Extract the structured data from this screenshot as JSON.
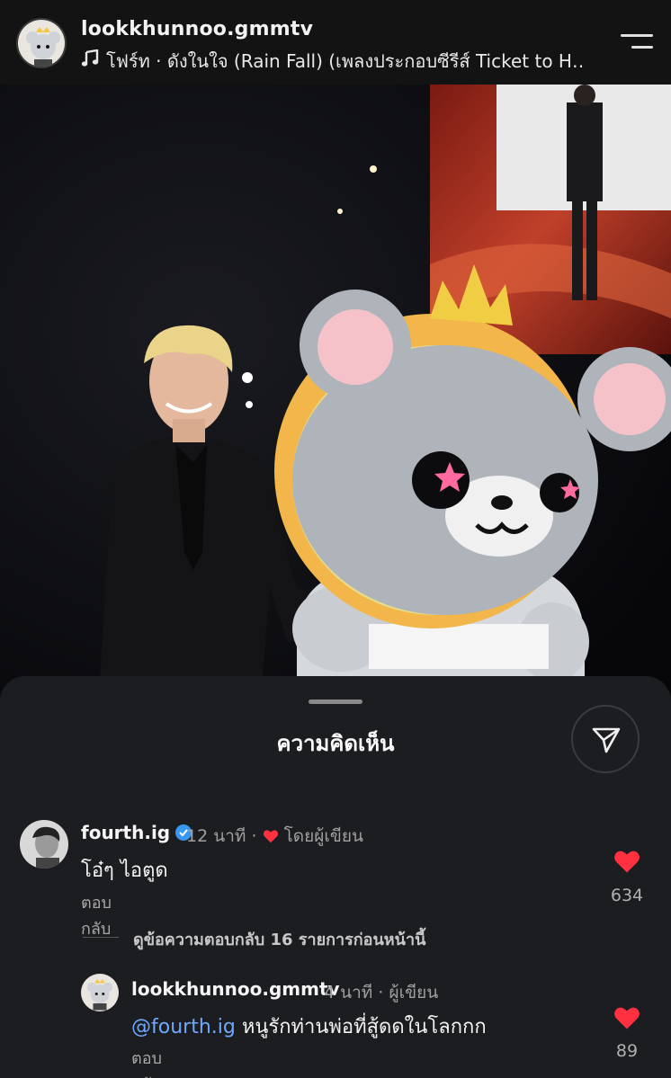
{
  "header": {
    "username": "lookkhunnoo.gmmtv",
    "music": "โฟร์ท · ดังในใจ (Rain Fall) (เพลงประกอบซีรีส์ Ticket to H…",
    "music_icon": "music-note-icon",
    "menu_icon": "menu-icon"
  },
  "post_image": {
    "description_alt": "photo"
  },
  "comments_sheet": {
    "title": "ความคิดเห็น",
    "share_icon": "paper-plane-icon",
    "comments": [
      {
        "username": "fourth.ig",
        "verified": true,
        "time": "12 นาที",
        "author_liked": "โดยผู้เขียน",
        "text": "โอ๋ๆ ไอตูด",
        "reply_label": "ตอบกลับ",
        "likes": "634"
      }
    ],
    "view_replies": "ดูข้อความตอบกลับ 16 รายการก่อนหน้านี้",
    "replies": [
      {
        "username": "lookkhunnoo.gmmtv",
        "time": "4 นาที",
        "badge": "ผู้เขียน",
        "mention": "@fourth.ig",
        "text": " หนูรักท่านพ่อที่สู้ดดในโลกกก",
        "reply_label": "ตอบกลับ",
        "likes": "89"
      }
    ]
  },
  "colors": {
    "background": "#1c1d20",
    "heart": "#ff3040",
    "mention": "#6ea8ff",
    "verified": "#3897f0"
  }
}
